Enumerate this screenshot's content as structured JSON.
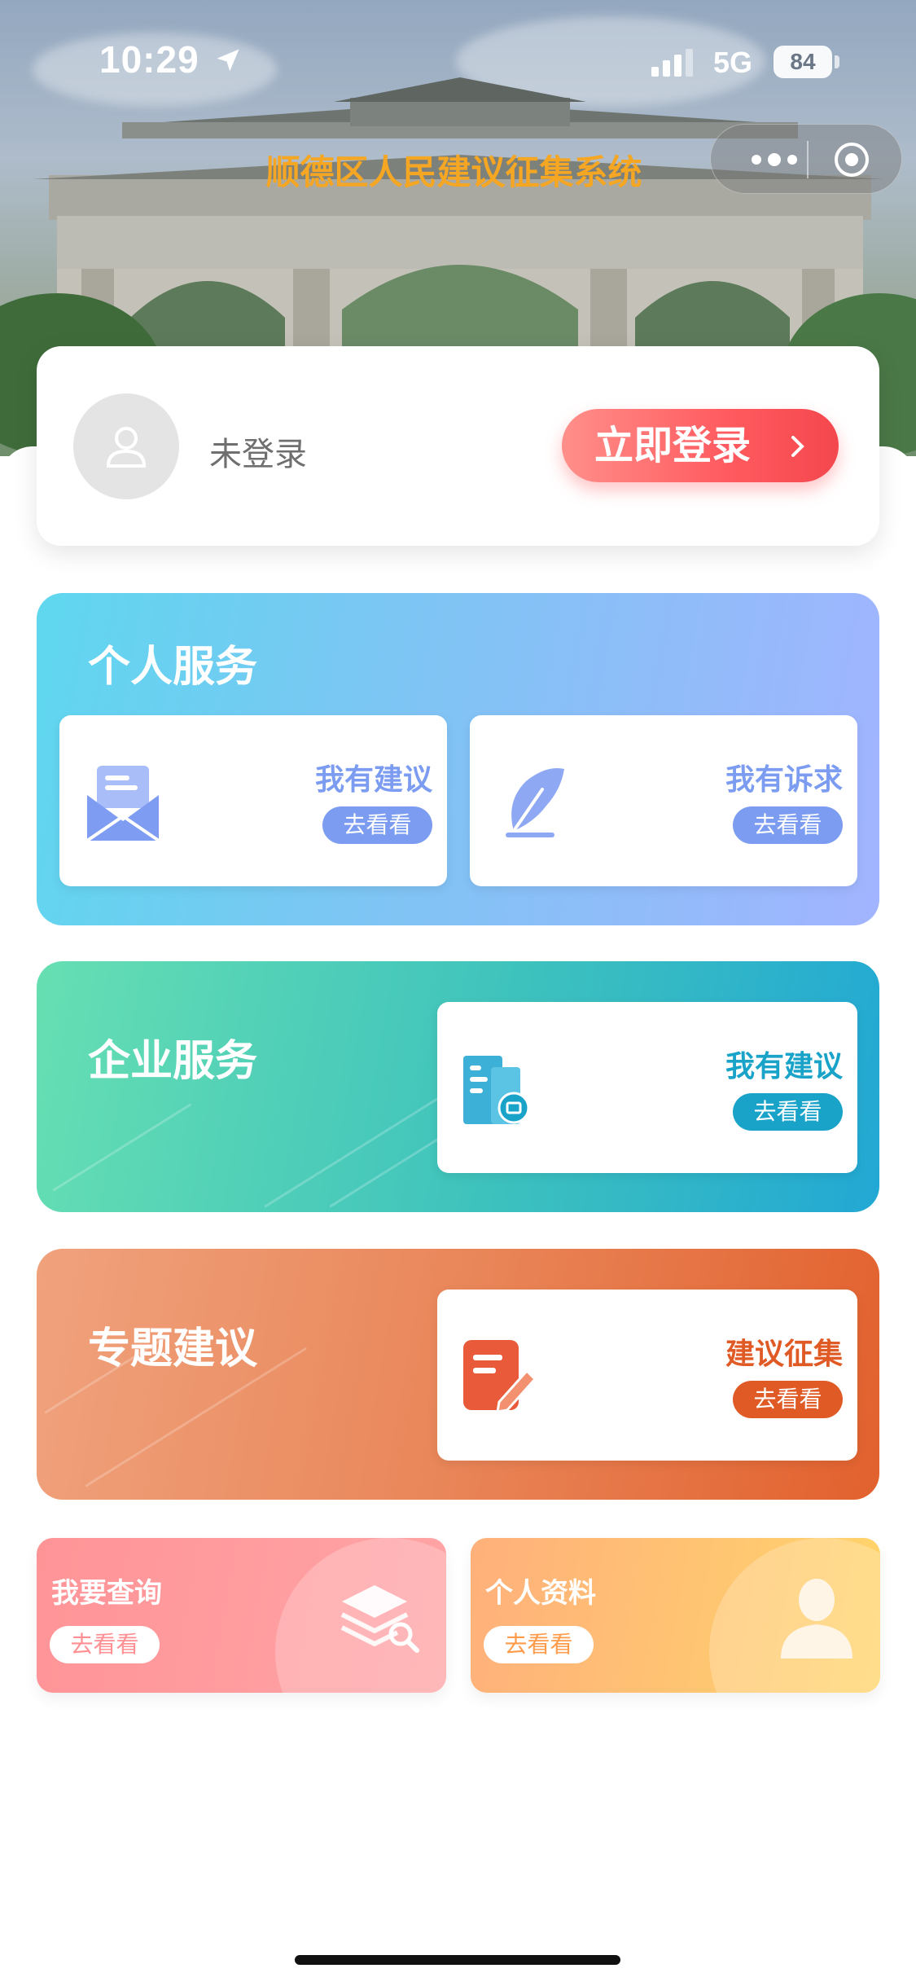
{
  "status_bar": {
    "time": "10:29",
    "network": "5G",
    "battery": "84"
  },
  "header": {
    "title": "顺德区人民建议征集系统"
  },
  "login": {
    "status": "未登录",
    "button_label": "立即登录"
  },
  "personal_service": {
    "title": "个人服务",
    "cards": [
      {
        "label": "我有建议",
        "action": "去看看",
        "icon": "envelope-icon"
      },
      {
        "label": "我有诉求",
        "action": "去看看",
        "icon": "feather-icon"
      }
    ]
  },
  "enterprise_service": {
    "title": "企业服务",
    "card": {
      "label": "我有建议",
      "action": "去看看",
      "icon": "building-icon"
    }
  },
  "topic_suggestion": {
    "title": "专题建议",
    "card": {
      "label": "建议征集",
      "action": "去看看",
      "icon": "edit-note-icon"
    }
  },
  "shortcuts": [
    {
      "label": "我要查询",
      "action": "去看看",
      "icon": "layers-search-icon"
    },
    {
      "label": "个人资料",
      "action": "去看看",
      "icon": "person-icon"
    }
  ],
  "colors": {
    "title_accent": "#f5a623",
    "login_button": "#ff5a5f",
    "personal_accent": "#7b9cf0",
    "enterprise_accent": "#1aa3c9",
    "topic_accent": "#e05a25",
    "query_accent": "#ff8f93",
    "profile_accent": "#ff9b4a"
  }
}
